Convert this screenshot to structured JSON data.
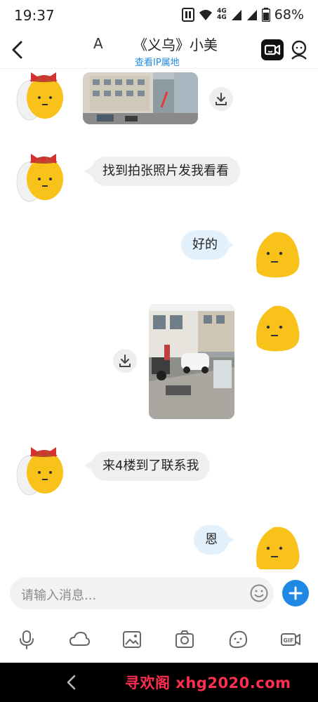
{
  "status_bar": {
    "time": "19:37",
    "network_top": "4G",
    "network_bottom": "4G",
    "battery": "68%"
  },
  "header": {
    "prefix": "A",
    "contact_name": "《义乌》小美",
    "ip_link": "查看IP属地"
  },
  "messages": [
    {
      "side": "left",
      "type": "image"
    },
    {
      "side": "left",
      "type": "text",
      "text": "找到拍张照片发我看看"
    },
    {
      "side": "right",
      "type": "text",
      "text": "好的"
    },
    {
      "side": "right",
      "type": "image"
    },
    {
      "side": "left",
      "type": "text",
      "text": "来4楼到了联系我"
    },
    {
      "side": "right",
      "type": "text",
      "text": "恩"
    }
  ],
  "input": {
    "placeholder": "请输入消息..."
  },
  "toolbar": [
    "mic-icon",
    "cloud-icon",
    "image-icon",
    "camera-icon",
    "sticker-icon",
    "gif-icon"
  ],
  "toolbar_gif_label": "GIF",
  "watermark": "寻欢阁 xhg2020.com",
  "colors": {
    "accent": "#1e88e5",
    "bubble_left": "#efefef",
    "bubble_right": "#e3f1fd",
    "avatar_yellow": "#f8c21a",
    "watermark": "#ff2d4f"
  }
}
